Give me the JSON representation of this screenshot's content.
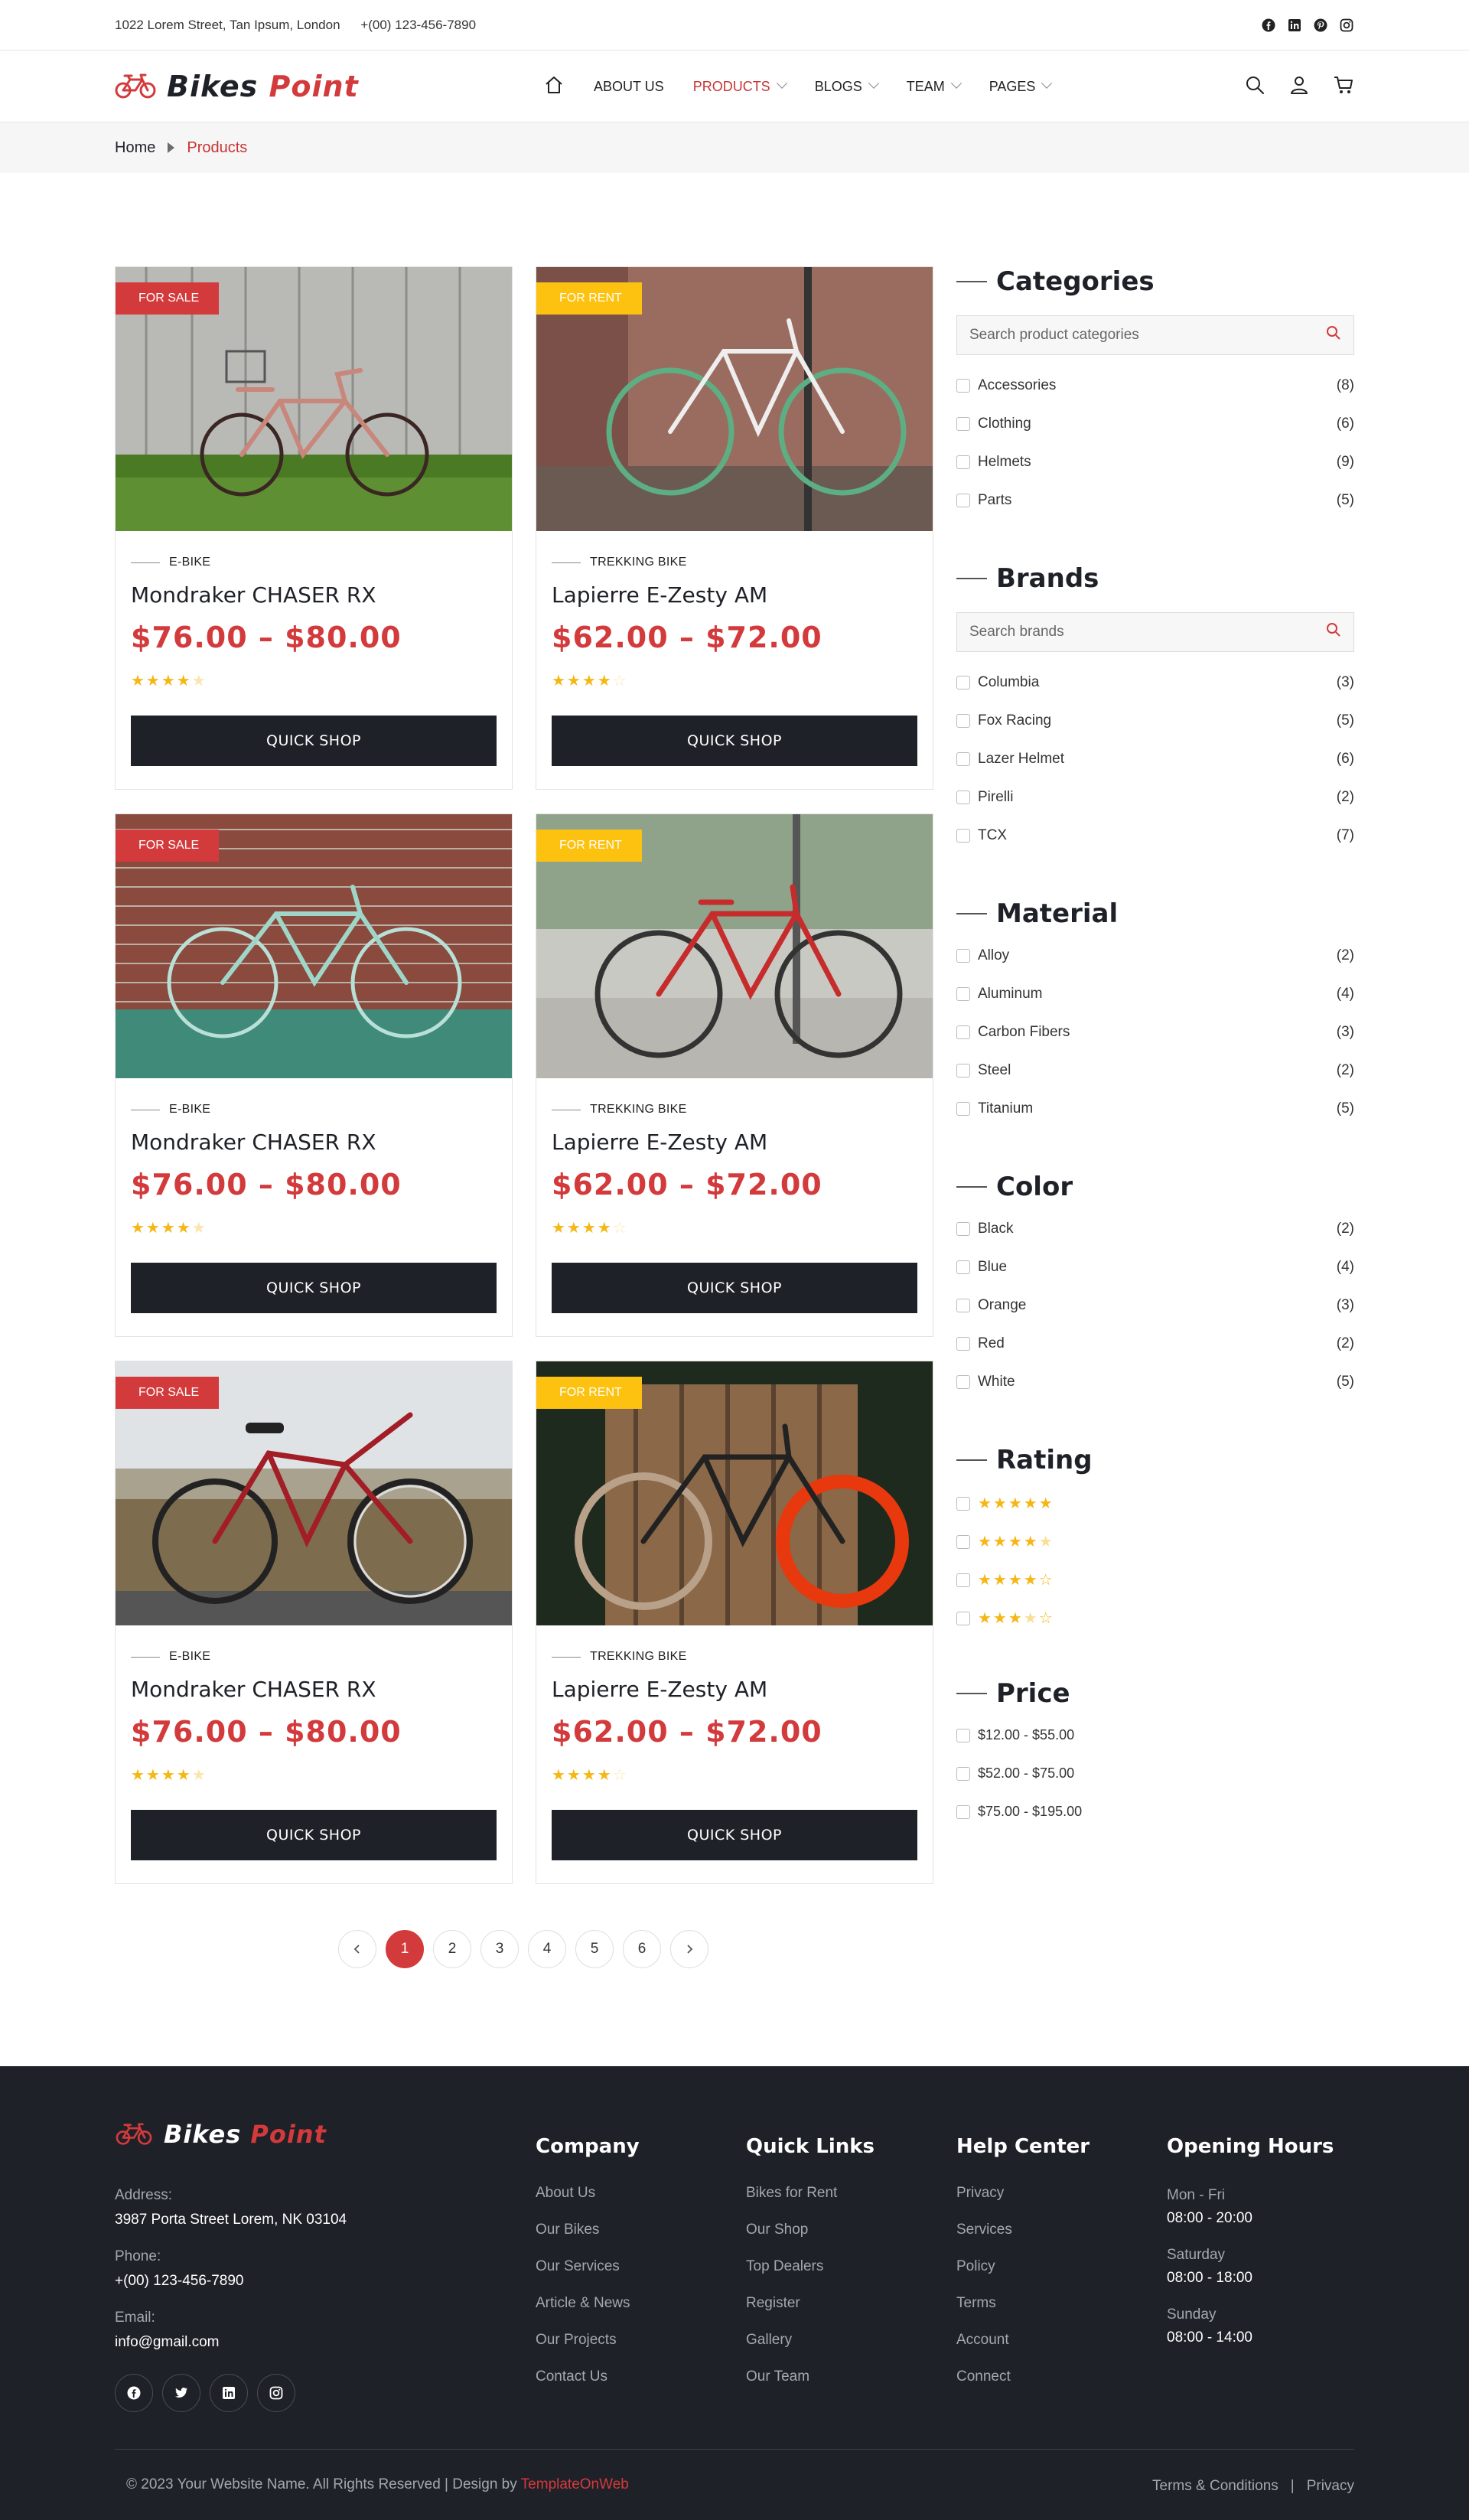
{
  "topbar": {
    "address": "1022 Lorem Street, Tan Ipsum, London",
    "phone": "+(00) 123-456-7890",
    "social": [
      "facebook-icon",
      "linkedin-icon",
      "pinterest-icon",
      "instagram-icon"
    ]
  },
  "brand": {
    "name_main": "Bikes ",
    "name_accent": "Point",
    "accent_color": "#d33a3c",
    "dark_color": "#1f2128"
  },
  "nav": {
    "home_icon": "home-icon",
    "items": [
      "ABOUT US",
      "PRODUCTS",
      "BLOGS",
      "TEAM",
      "PAGES"
    ],
    "active": "PRODUCTS"
  },
  "breadcrumb": {
    "home": "Home",
    "current": "Products"
  },
  "products": [
    {
      "badge": "FOR SALE",
      "category": "E-BIKE",
      "title": "Mondraker CHASER RX",
      "price": "$76.00 – $80.00",
      "rating": 4.5,
      "button": "QUICK SHOP"
    },
    {
      "badge": "FOR RENT",
      "category": "TREKKING BIKE",
      "title": "Lapierre E-Zesty AM",
      "price": "$62.00 – $72.00",
      "rating": 4,
      "button": "QUICK SHOP"
    },
    {
      "badge": "FOR SALE",
      "category": "E-BIKE",
      "title": "Mondraker CHASER RX",
      "price": "$76.00 – $80.00",
      "rating": 4.5,
      "button": "QUICK SHOP"
    },
    {
      "badge": "FOR RENT",
      "category": "TREKKING BIKE",
      "title": "Lapierre E-Zesty AM",
      "price": "$62.00 – $72.00",
      "rating": 4,
      "button": "QUICK SHOP"
    },
    {
      "badge": "FOR SALE",
      "category": "E-BIKE",
      "title": "Mondraker CHASER RX",
      "price": "$76.00 – $80.00",
      "rating": 4.5,
      "button": "QUICK SHOP"
    },
    {
      "badge": "FOR RENT",
      "category": "TREKKING BIKE",
      "title": "Lapierre E-Zesty AM",
      "price": "$62.00 – $72.00",
      "rating": 4,
      "button": "QUICK SHOP"
    }
  ],
  "sidebar": {
    "categories": {
      "title": "Categories",
      "search_placeholder": "Search product categories",
      "items": [
        {
          "label": "Accessories",
          "count": "(8)"
        },
        {
          "label": "Clothing",
          "count": "(6)"
        },
        {
          "label": "Helmets",
          "count": "(9)"
        },
        {
          "label": "Parts",
          "count": "(5)"
        }
      ]
    },
    "brands": {
      "title": "Brands",
      "search_placeholder": "Search brands",
      "items": [
        {
          "label": "Columbia",
          "count": "(3)"
        },
        {
          "label": "Fox Racing",
          "count": "(5)"
        },
        {
          "label": "Lazer Helmet",
          "count": "(6)"
        },
        {
          "label": "Pirelli",
          "count": "(2)"
        },
        {
          "label": "TCX",
          "count": "(7)"
        }
      ]
    },
    "material": {
      "title": "Material",
      "items": [
        {
          "label": "Alloy",
          "count": "(2)"
        },
        {
          "label": "Aluminum",
          "count": "(4)"
        },
        {
          "label": "Carbon Fibers",
          "count": "(3)"
        },
        {
          "label": "Steel",
          "count": "(2)"
        },
        {
          "label": "Titanium",
          "count": "(5)"
        }
      ]
    },
    "color": {
      "title": "Color",
      "items": [
        {
          "label": "Black",
          "count": "(2)"
        },
        {
          "label": "Blue",
          "count": "(4)"
        },
        {
          "label": "Orange",
          "count": "(3)"
        },
        {
          "label": "Red",
          "count": "(2)"
        },
        {
          "label": "White",
          "count": "(5)"
        }
      ]
    },
    "rating": {
      "title": "Rating",
      "levels": [
        5,
        4.5,
        4,
        3.5
      ]
    },
    "price": {
      "title": "Price",
      "items": [
        "$12.00 - $55.00",
        "$52.00 - $75.00",
        "$75.00 - $195.00"
      ]
    }
  },
  "pagination": {
    "pages": [
      "1",
      "2",
      "3",
      "4",
      "5",
      "6"
    ],
    "current": "1"
  },
  "footer": {
    "address_label": "Address:",
    "address": "3987 Porta Street Lorem, NK 03104",
    "phone_label": "Phone:",
    "phone": "+(00) 123-456-7890",
    "email_label": "Email:",
    "email": "info@gmail.com",
    "social": [
      "facebook-icon",
      "twitter-icon",
      "linkedin-icon",
      "instagram-icon"
    ],
    "columns": [
      {
        "title": "Company",
        "links": [
          "About Us",
          "Our Bikes",
          "Our Services",
          "Article & News",
          "Our Projects",
          "Contact Us"
        ]
      },
      {
        "title": "Quick Links",
        "links": [
          "Bikes for Rent",
          "Our Shop",
          "Top Dealers",
          "Register",
          "Gallery",
          "Our Team"
        ]
      },
      {
        "title": "Help Center",
        "links": [
          "Privacy",
          "Services",
          "Policy",
          "Terms",
          "Account",
          "Connect"
        ]
      }
    ],
    "hours": {
      "title": "Opening Hours",
      "rows": [
        {
          "day": "Mon - Fri",
          "time": "08:00 - 20:00"
        },
        {
          "day": "Saturday",
          "time": "08:00 - 18:00"
        },
        {
          "day": "Sunday",
          "time": "08:00 - 14:00"
        }
      ]
    },
    "copyright": "© 2023 Your Website Name. All Rights Reserved | Design by ",
    "designer": "TemplateOnWeb",
    "bottom_links": [
      "Terms & Conditions",
      "|",
      "Privacy"
    ]
  }
}
